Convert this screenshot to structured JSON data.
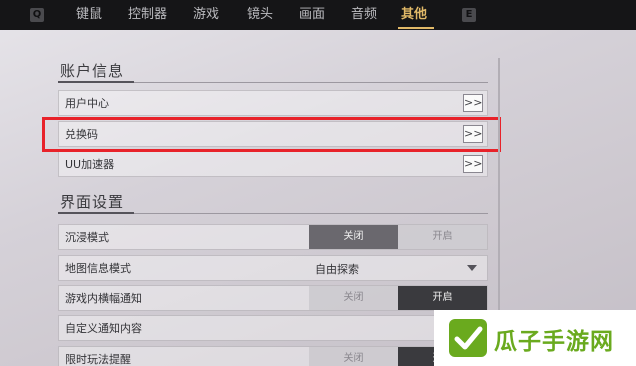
{
  "topbar": {
    "left_key": "Q",
    "right_key": "E",
    "tabs": [
      {
        "label": "键鼠"
      },
      {
        "label": "控制器"
      },
      {
        "label": "游戏"
      },
      {
        "label": "镜头"
      },
      {
        "label": "画面"
      },
      {
        "label": "音频"
      },
      {
        "label": "其他",
        "active": true
      }
    ]
  },
  "account": {
    "title": "账户信息",
    "items": [
      {
        "label": "用户中心",
        "button": ">>"
      },
      {
        "label": "兑换码",
        "button": ">>",
        "highlighted": true
      },
      {
        "label": "UU加速器",
        "button": ">>"
      }
    ]
  },
  "interface": {
    "title": "界面设置",
    "immersive": {
      "label": "沉浸模式",
      "options": [
        "关闭",
        "开启"
      ],
      "selected": "关闭"
    },
    "map_info": {
      "label": "地图信息模式",
      "value": "自由探索"
    },
    "banner": {
      "label": "游戏内横幅通知",
      "options": [
        "关闭",
        "开启"
      ],
      "selected": "开启"
    },
    "custom_notice": {
      "label": "自定义通知内容"
    },
    "limited_event": {
      "label": "限时玩法提醒",
      "options": [
        "关闭",
        "开启"
      ],
      "selected": "开启"
    }
  },
  "watermark": {
    "text": "瓜子手游网",
    "logo_color": "#6aaa1e"
  },
  "colors": {
    "accent": "#e1b968",
    "highlight": "#e8222a"
  }
}
